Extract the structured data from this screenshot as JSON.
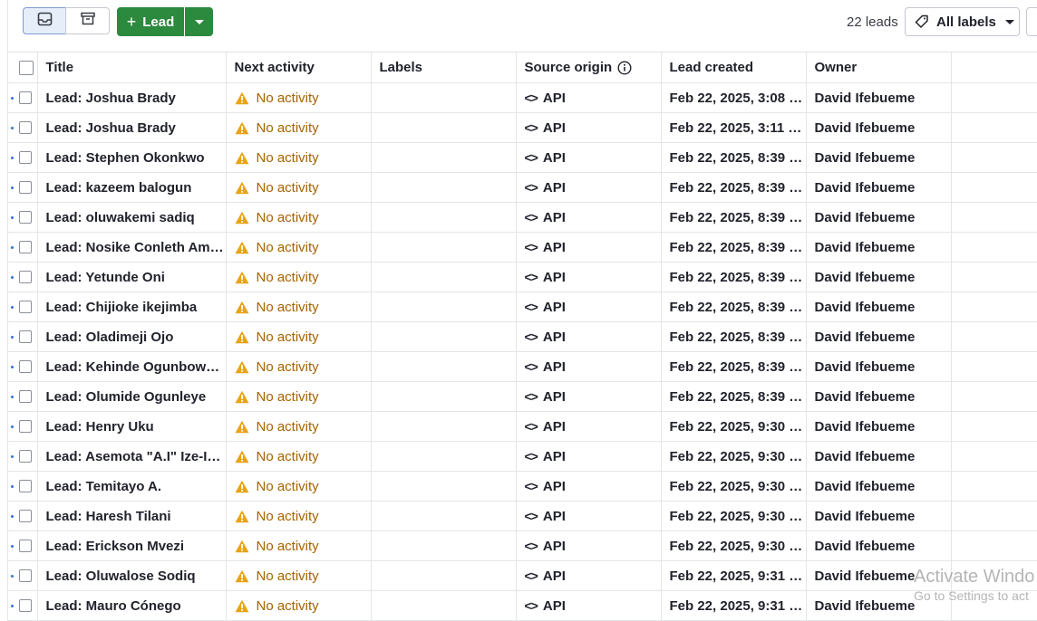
{
  "toolbar": {
    "add_button_label": "Lead",
    "lead_count": "22 leads",
    "labels_filter": "All labels"
  },
  "table": {
    "columns": {
      "title": "Title",
      "next_activity": "Next activity",
      "labels": "Labels",
      "source_origin": "Source origin",
      "lead_created": "Lead created",
      "owner": "Owner"
    },
    "rows": [
      {
        "title": "Lead: Joshua Brady",
        "activity": "No activity",
        "labels": "",
        "source": "API",
        "created": "Feb 22, 2025, 3:08 …",
        "owner": "David Ifebueme"
      },
      {
        "title": "Lead: Joshua Brady",
        "activity": "No activity",
        "labels": "",
        "source": "API",
        "created": "Feb 22, 2025, 3:11 …",
        "owner": "David Ifebueme"
      },
      {
        "title": "Lead: Stephen Okonkwo",
        "activity": "No activity",
        "labels": "",
        "source": "API",
        "created": "Feb 22, 2025, 8:39 …",
        "owner": "David Ifebueme"
      },
      {
        "title": "Lead: kazeem balogun",
        "activity": "No activity",
        "labels": "",
        "source": "API",
        "created": "Feb 22, 2025, 8:39 …",
        "owner": "David Ifebueme"
      },
      {
        "title": "Lead: oluwakemi sadiq",
        "activity": "No activity",
        "labels": "",
        "source": "API",
        "created": "Feb 22, 2025, 8:39 …",
        "owner": "David Ifebueme"
      },
      {
        "title": "Lead: Nosike Conleth Am…",
        "activity": "No activity",
        "labels": "",
        "source": "API",
        "created": "Feb 22, 2025, 8:39 …",
        "owner": "David Ifebueme"
      },
      {
        "title": "Lead: Yetunde Oni",
        "activity": "No activity",
        "labels": "",
        "source": "API",
        "created": "Feb 22, 2025, 8:39 …",
        "owner": "David Ifebueme"
      },
      {
        "title": "Lead: Chijioke ikejimba",
        "activity": "No activity",
        "labels": "",
        "source": "API",
        "created": "Feb 22, 2025, 8:39 …",
        "owner": "David Ifebueme"
      },
      {
        "title": "Lead: Oladimeji Ojo",
        "activity": "No activity",
        "labels": "",
        "source": "API",
        "created": "Feb 22, 2025, 8:39 …",
        "owner": "David Ifebueme"
      },
      {
        "title": "Lead: Kehinde Ogunbow…",
        "activity": "No activity",
        "labels": "",
        "source": "API",
        "created": "Feb 22, 2025, 8:39 …",
        "owner": "David Ifebueme"
      },
      {
        "title": "Lead: Olumide Ogunleye",
        "activity": "No activity",
        "labels": "",
        "source": "API",
        "created": "Feb 22, 2025, 8:39 …",
        "owner": "David Ifebueme"
      },
      {
        "title": "Lead: Henry Uku",
        "activity": "No activity",
        "labels": "",
        "source": "API",
        "created": "Feb 22, 2025, 9:30 …",
        "owner": "David Ifebueme"
      },
      {
        "title": "Lead: Asemota \"A.I\" Ize-I…",
        "activity": "No activity",
        "labels": "",
        "source": "API",
        "created": "Feb 22, 2025, 9:30 …",
        "owner": "David Ifebueme"
      },
      {
        "title": "Lead: Temitayo A.",
        "activity": "No activity",
        "labels": "",
        "source": "API",
        "created": "Feb 22, 2025, 9:30 …",
        "owner": "David Ifebueme"
      },
      {
        "title": "Lead: Haresh Tilani",
        "activity": "No activity",
        "labels": "",
        "source": "API",
        "created": "Feb 22, 2025, 9:30 …",
        "owner": "David Ifebueme"
      },
      {
        "title": "Lead: Erickson Mvezi",
        "activity": "No activity",
        "labels": "",
        "source": "API",
        "created": "Feb 22, 2025, 9:30 …",
        "owner": "David Ifebueme"
      },
      {
        "title": "Lead: Oluwalose Sodiq",
        "activity": "No activity",
        "labels": "",
        "source": "API",
        "created": "Feb 22, 2025, 9:31 …",
        "owner": "David Ifebueme"
      },
      {
        "title": "Lead: Mauro Cónego",
        "activity": "No activity",
        "labels": "",
        "source": "API",
        "created": "Feb 22, 2025, 9:31 …",
        "owner": "David Ifebueme"
      }
    ]
  },
  "watermark": {
    "line1": "Activate Windo",
    "line2": "Go to Settings to act"
  },
  "colors": {
    "primary_green": "#2b8a3e",
    "warning_amber": "#e8a317",
    "warning_text": "#a66300",
    "unread_dot": "#3372d4"
  },
  "icons": {
    "inbox": "inbox-icon",
    "archive": "archive-icon",
    "add": "plus-icon",
    "dropdown": "chevron-down-icon",
    "labels": "tag-icon",
    "info": "info-icon",
    "warning": "warning-icon",
    "source": "code-icon"
  }
}
